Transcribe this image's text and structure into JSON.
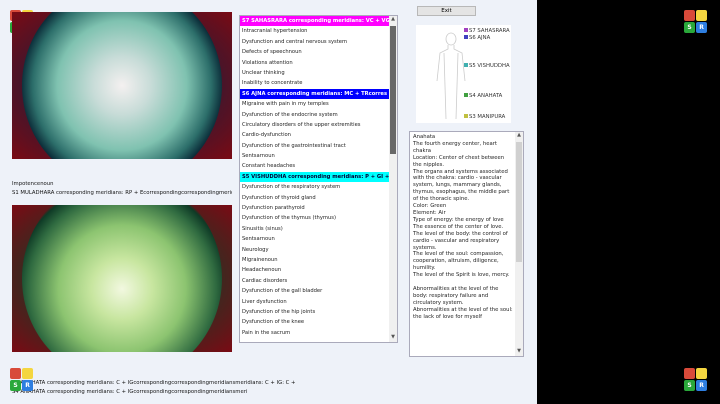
{
  "colors": {
    "sahasrara": "#ff00ff",
    "ajna": "#0000ff",
    "vishuddha": "#00ffff",
    "anahata": "#00cc66"
  },
  "logo": {
    "letters": [
      "",
      "",
      "S",
      "R"
    ]
  },
  "top_image_caption": "Impotencenoun",
  "top_image_label": "S1 MULADHARA corresponding meridians: RP + Ecorrespondingcorrespondingmeridians",
  "bottom_lines": [
    "S4 ANAHATA corresponding meridians: C + IGcorrespondingcorrespondingmeridiansmeridians: C + IG: C +",
    "S4 ANAHATA corresponding meridians: C + IGcorrespondingcorrespondingmeridiansmeri"
  ],
  "list": [
    {
      "text": "S7 SAHASRARA corresponding meridians: VC + VG",
      "header": "sahasrara"
    },
    {
      "text": "Intracranial hypertension"
    },
    {
      "text": "Dysfunction and central nervous system"
    },
    {
      "text": "Defects of speechnoun"
    },
    {
      "text": "Violations attention"
    },
    {
      "text": "Unclear thinking"
    },
    {
      "text": "Inability to concentrate"
    },
    {
      "text": "S6 AJNA corresponding meridians: MC + TRcorres",
      "header": "ajna"
    },
    {
      "text": "Migraine with pain in my temples"
    },
    {
      "text": "Dysfunction of the endocrine system"
    },
    {
      "text": "Circulatory disorders of the upper extremities"
    },
    {
      "text": "Cardio-dysfunction"
    },
    {
      "text": "Dysfunction of the gastrointestinal tract"
    },
    {
      "text": "Sentsarnoun"
    },
    {
      "text": "Constant headaches"
    },
    {
      "text": "S5 VISHUDDHA corresponding meridians: P + GI +",
      "header": "vishuddha"
    },
    {
      "text": "Dysfunction of the respiratory system"
    },
    {
      "text": "Dysfunction of thyroid gland"
    },
    {
      "text": "Dysfunction parathyroid"
    },
    {
      "text": "Dysfunction of the thymus (thymus)"
    },
    {
      "text": "Sinusitis (sinus)"
    },
    {
      "text": "Sentsarnoun"
    },
    {
      "text": "Neurology"
    },
    {
      "text": "Migrainenoun"
    },
    {
      "text": "Headachenoun"
    },
    {
      "text": "Cardiac disorders"
    },
    {
      "text": "Dysfunction of the gall bladder"
    },
    {
      "text": "Liver dysfunction"
    },
    {
      "text": "Dysfunction of the hip joints"
    },
    {
      "text": "Dysfunction of the knee"
    },
    {
      "text": "Pain in the sacrum"
    }
  ],
  "exit_label": "Exit",
  "chakra_labels": [
    {
      "text": "S7 SAHASRARA",
      "color": "#a040c0"
    },
    {
      "text": "S6 AJNA",
      "color": "#4040c0"
    },
    {
      "text": "S5 VISHUDDHA",
      "color": "#40b0b0"
    },
    {
      "text": "S4 ANAHATA",
      "color": "#40a040"
    },
    {
      "text": "S3 MANIPURA",
      "color": "#c0c040"
    },
    {
      "text": "S2 SVADHISTANA",
      "color": "#c09040"
    },
    {
      "text": "S1 MULADHARA",
      "color": "#c03040"
    }
  ],
  "description": "Anahata\nThe fourth energy center, heart chakra\nLocation: Center of chest between the nipples.\nThe organs and systems associated with the chakra: cardio - vascular system, lungs, mammary glands, thymus, esophagus, the middle part of the thoracic spine.\nColor: Green\nElement: Air\nType of energy: the energy of love\nThe essence of the center of love.\nThe level of the body: the control of cardio - vascular and respiratory systems.\nThe level of the soul: compassion, cooperation, altruism, diligence, humility.\nThe level of the Spirit is love, mercy.\n\nAbnormalities at the level of the body: respiratory failure and circulatory system.\nAbnormalities at the level of the soul: the lack of love for myself"
}
